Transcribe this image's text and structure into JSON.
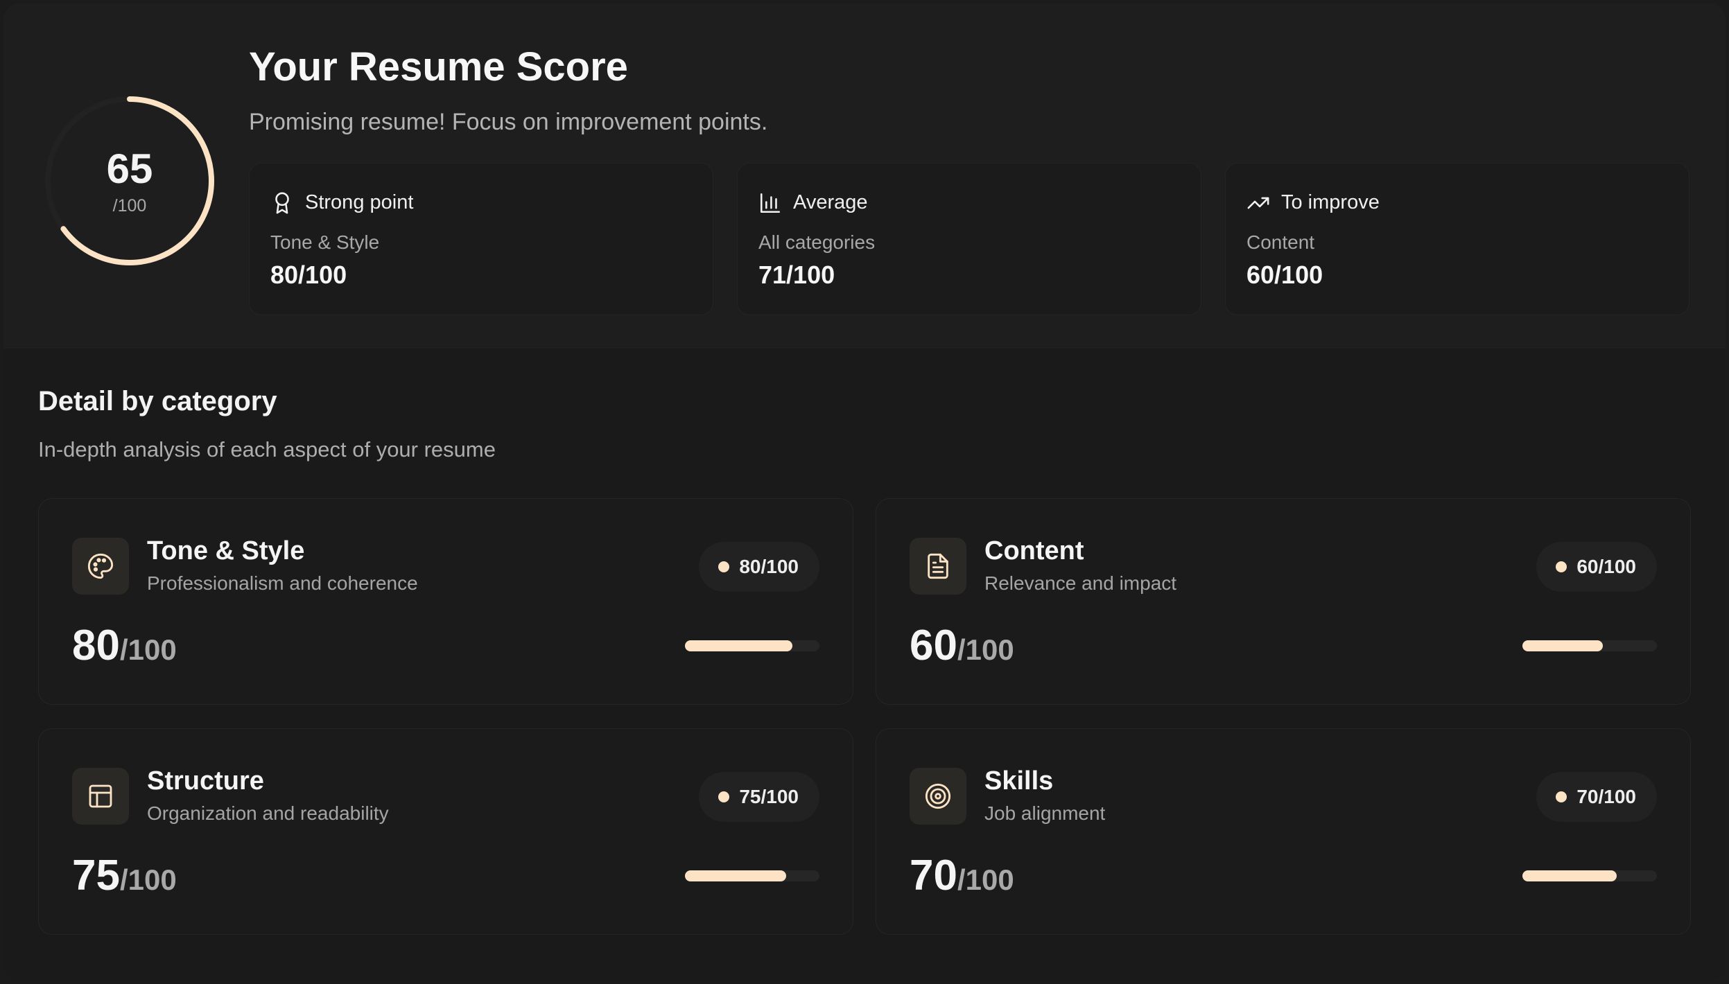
{
  "header": {
    "score": "65",
    "score_total": "/100",
    "score_fraction": 0.65,
    "title": "Your Resume Score",
    "subtitle": "Promising resume! Focus on improvement points."
  },
  "summary": [
    {
      "label": "Strong point",
      "category": "Tone & Style",
      "score": "80/100",
      "icon": "award-icon"
    },
    {
      "label": "Average",
      "category": "All categories",
      "score": "71/100",
      "icon": "bar-chart-icon"
    },
    {
      "label": "To improve",
      "category": "Content",
      "score": "60/100",
      "icon": "trending-up-icon"
    }
  ],
  "details": {
    "title": "Detail by category",
    "subtitle": "In-depth analysis of each aspect of your resume",
    "categories": [
      {
        "name": "Tone & Style",
        "description": "Professionalism and coherence",
        "badge": "80/100",
        "score": "80",
        "total": "/100",
        "fraction": 0.8,
        "icon": "palette-icon"
      },
      {
        "name": "Content",
        "description": "Relevance and impact",
        "badge": "60/100",
        "score": "60",
        "total": "/100",
        "fraction": 0.6,
        "icon": "file-text-icon"
      },
      {
        "name": "Structure",
        "description": "Organization and readability",
        "badge": "75/100",
        "score": "75",
        "total": "/100",
        "fraction": 0.75,
        "icon": "layout-icon"
      },
      {
        "name": "Skills",
        "description": "Job alignment",
        "badge": "70/100",
        "score": "70",
        "total": "/100",
        "fraction": 0.7,
        "icon": "target-icon"
      }
    ]
  },
  "colors": {
    "accent": "#fde3c5",
    "background": "#1a1a1a",
    "card": "#1b1b1b",
    "muted_text": "#a9a9a9"
  }
}
